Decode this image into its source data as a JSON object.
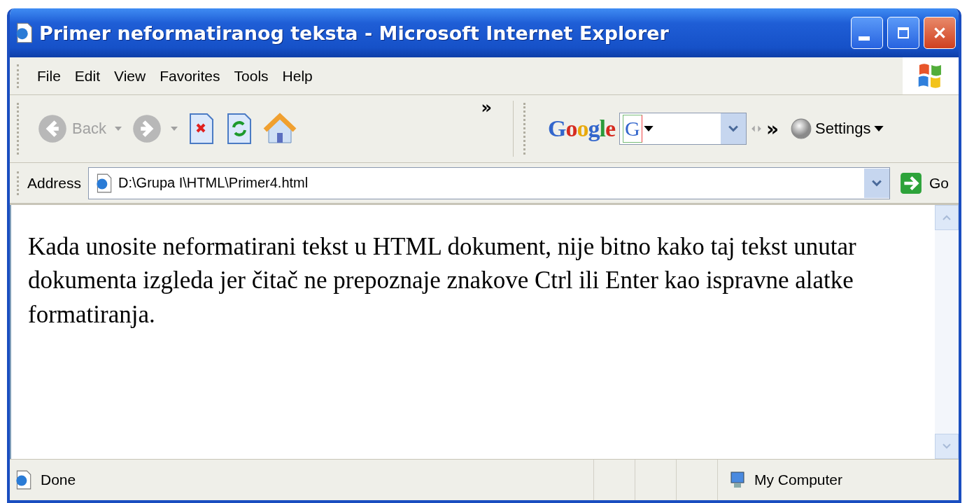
{
  "window": {
    "title": "Primer neformatiranog teksta - Microsoft Internet Explorer"
  },
  "menu": [
    "File",
    "Edit",
    "View",
    "Favorites",
    "Tools",
    "Help"
  ],
  "toolbar": {
    "back": {
      "label": "Back",
      "disabled": true
    },
    "forward": {
      "disabled": true
    },
    "overflow": "»"
  },
  "google_bar": {
    "logo": "Google",
    "search_icon": "G",
    "overflow": "»",
    "settings": "Settings"
  },
  "address_bar": {
    "label": "Address",
    "value": "D:\\Grupa I\\HTML\\Primer4.html",
    "go": "Go"
  },
  "content": {
    "paragraph": "Kada unosite neformatirani tekst u HTML dokument, nije bitno kako taj tekst unutar dokumenta izgleda jer čitač ne prepoznaje znakove Ctrl ili Enter kao ispravne alatke formatiranja."
  },
  "status_bar": {
    "status": "Done",
    "zone": "My Computer"
  }
}
